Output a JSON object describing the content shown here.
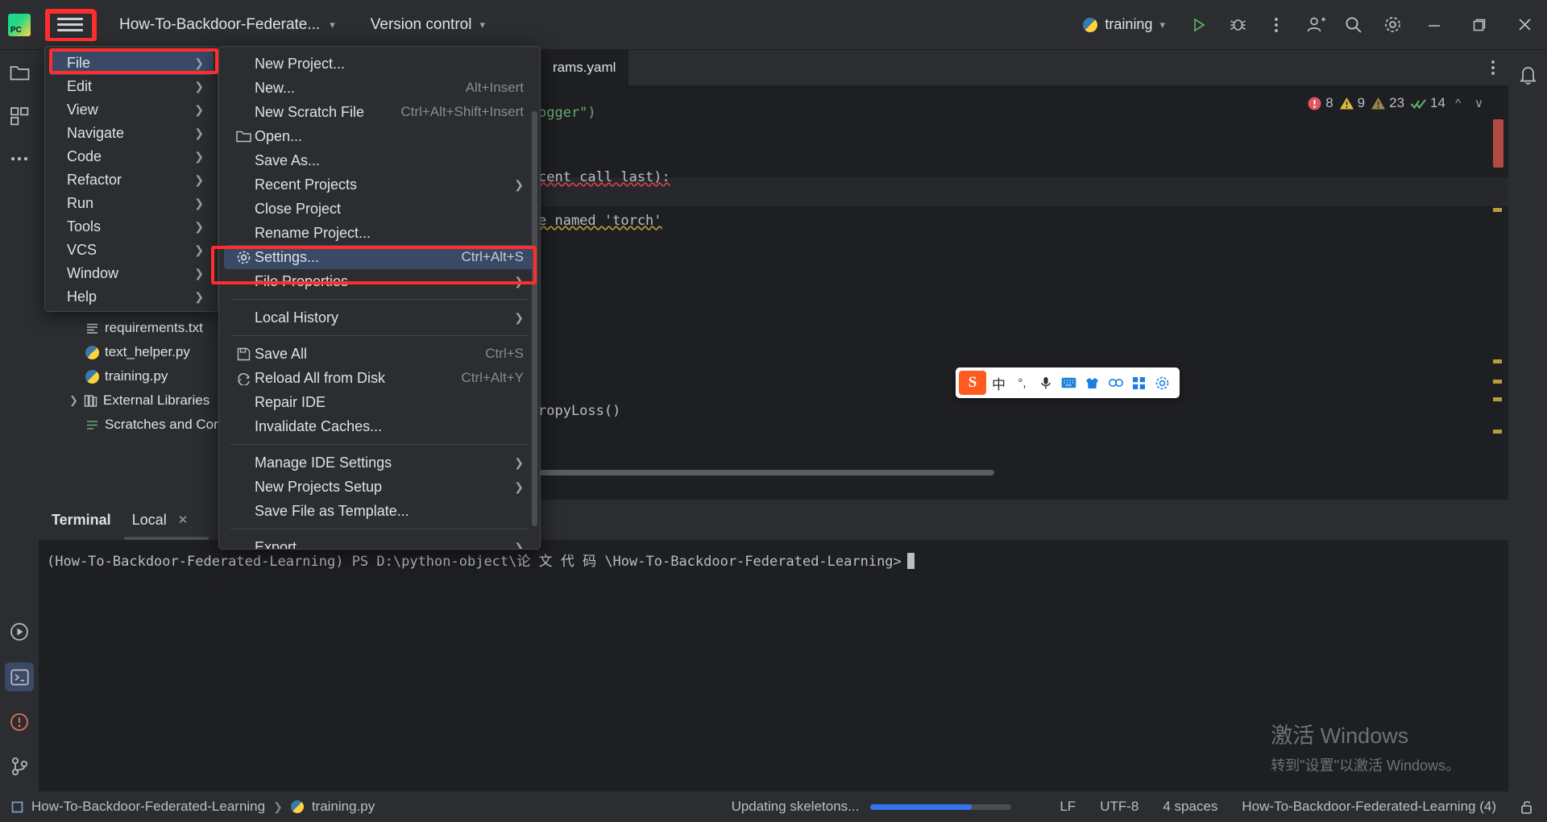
{
  "titlebar": {
    "logo": "pycharm-logo",
    "project_name": "How-To-Backdoor-Federate...",
    "version_control": "Version control",
    "run_config": "training",
    "icons": [
      "hamburger-icon",
      "run-icon",
      "debug-icon",
      "more-icon",
      "account-icon",
      "search-icon",
      "settings-icon",
      "minimize-icon",
      "maximize-icon",
      "close-icon"
    ]
  },
  "project_tree": {
    "items": [
      {
        "label": "requirements.txt",
        "icon": "text-file-icon",
        "indent": 2
      },
      {
        "label": "text_helper.py",
        "icon": "python-file-icon",
        "indent": 2
      },
      {
        "label": "training.py",
        "icon": "python-file-icon",
        "indent": 2
      },
      {
        "label": "External Libraries",
        "icon": "library-icon",
        "indent": 1
      },
      {
        "label": "Scratches and Consc",
        "icon": "scratches-icon",
        "indent": 2
      }
    ]
  },
  "main_menu": {
    "items": [
      {
        "label": "File",
        "selected": true
      },
      {
        "label": "Edit",
        "selected": false
      },
      {
        "label": "View",
        "selected": false
      },
      {
        "label": "Navigate",
        "selected": false
      },
      {
        "label": "Code",
        "selected": false
      },
      {
        "label": "Refactor",
        "selected": false
      },
      {
        "label": "Run",
        "selected": false
      },
      {
        "label": "Tools",
        "selected": false
      },
      {
        "label": "VCS",
        "selected": false
      },
      {
        "label": "Window",
        "selected": false
      },
      {
        "label": "Help",
        "selected": false
      }
    ]
  },
  "file_menu": {
    "items": [
      {
        "label": "New Project...",
        "shortcut": "",
        "icon": "",
        "arrow": false
      },
      {
        "label": "New...",
        "shortcut": "Alt+Insert",
        "icon": "",
        "arrow": false
      },
      {
        "label": "New Scratch File",
        "shortcut": "Ctrl+Alt+Shift+Insert",
        "icon": "",
        "arrow": false
      },
      {
        "label": "Open...",
        "shortcut": "",
        "icon": "folder-icon",
        "arrow": false
      },
      {
        "label": "Save As...",
        "shortcut": "",
        "icon": "",
        "arrow": false
      },
      {
        "label": "Recent Projects",
        "shortcut": "",
        "icon": "",
        "arrow": true
      },
      {
        "label": "Close Project",
        "shortcut": "",
        "icon": "",
        "arrow": false
      },
      {
        "label": "Rename Project...",
        "shortcut": "",
        "icon": "",
        "arrow": false
      },
      {
        "label": "Settings...",
        "shortcut": "Ctrl+Alt+S",
        "icon": "gear-icon",
        "arrow": false,
        "selected": true
      },
      {
        "label": "File Properties",
        "shortcut": "",
        "icon": "",
        "arrow": true
      },
      {
        "label": "Local History",
        "shortcut": "",
        "icon": "",
        "arrow": true
      },
      {
        "label": "Save All",
        "shortcut": "Ctrl+S",
        "icon": "save-icon",
        "arrow": false
      },
      {
        "label": "Reload All from Disk",
        "shortcut": "Ctrl+Alt+Y",
        "icon": "reload-icon",
        "arrow": false
      },
      {
        "label": "Repair IDE",
        "shortcut": "",
        "icon": "",
        "arrow": false
      },
      {
        "label": "Invalidate Caches...",
        "shortcut": "",
        "icon": "",
        "arrow": false
      },
      {
        "label": "Manage IDE Settings",
        "shortcut": "",
        "icon": "",
        "arrow": true
      },
      {
        "label": "New Projects Setup",
        "shortcut": "",
        "icon": "",
        "arrow": true
      },
      {
        "label": "Save File as Template...",
        "shortcut": "",
        "icon": "",
        "arrow": false
      },
      {
        "label": "Export",
        "shortcut": "",
        "icon": "",
        "arrow": true
      }
    ]
  },
  "editor": {
    "tab_label": "rams.yaml",
    "inspections": {
      "errors": "8",
      "warnings": "9",
      "weak_warnings": "23",
      "checks": "14"
    },
    "code_lines": [
      "ogger\")",
      "",
      "cent call last):",
      "",
      "e named 'torch'",
      "",
      "",
      "ropyLoss()"
    ]
  },
  "ime_bar": {
    "logo": "S",
    "buttons": [
      "中",
      "°,",
      "mic-icon",
      "keyboard-icon",
      "shirt-icon",
      "link-icon",
      "grid-icon",
      "settings-icon"
    ]
  },
  "terminal": {
    "title": "Terminal",
    "tab": "Local",
    "prompt_line": "(How-To-Backdoor-Federated-Learning) PS D:\\python-object\\论 文 代 码 \\How-To-Backdoor-Federated-Learning>"
  },
  "watermark": {
    "line1": "激活 Windows",
    "line2": "转到\"设置\"以激活 Windows。"
  },
  "statusbar": {
    "breadcrumb_project": "How-To-Backdoor-Federated-Learning",
    "breadcrumb_file": "training.py",
    "progress_text": "Updating skeletons...",
    "progress_percent": 72,
    "line_separator": "LF",
    "encoding": "UTF-8",
    "indent": "4 spaces",
    "interpreter": "How-To-Backdoor-Federated-Learning (4)",
    "lock_icon": "unlocked-icon"
  },
  "colors": {
    "accent": "#3574f0",
    "highlight": "#3a4a66",
    "annotation_red": "#ff2d2d",
    "error": "#d0453b",
    "warning": "#b89c3e",
    "success": "#5fad65",
    "panel": "#2b2d30",
    "editor_bg": "#1e1f22"
  }
}
